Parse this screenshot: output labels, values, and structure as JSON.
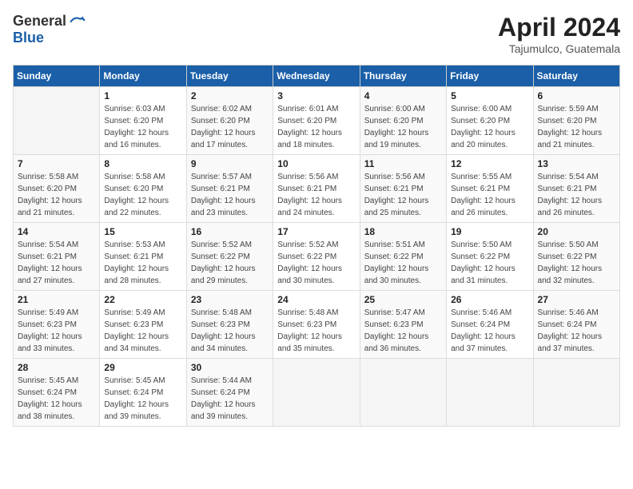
{
  "logo": {
    "general": "General",
    "blue": "Blue"
  },
  "title": {
    "month": "April 2024",
    "location": "Tajumulco, Guatemala"
  },
  "headers": [
    "Sunday",
    "Monday",
    "Tuesday",
    "Wednesday",
    "Thursday",
    "Friday",
    "Saturday"
  ],
  "weeks": [
    [
      {
        "day": "",
        "info": ""
      },
      {
        "day": "1",
        "info": "Sunrise: 6:03 AM\nSunset: 6:20 PM\nDaylight: 12 hours\nand 16 minutes."
      },
      {
        "day": "2",
        "info": "Sunrise: 6:02 AM\nSunset: 6:20 PM\nDaylight: 12 hours\nand 17 minutes."
      },
      {
        "day": "3",
        "info": "Sunrise: 6:01 AM\nSunset: 6:20 PM\nDaylight: 12 hours\nand 18 minutes."
      },
      {
        "day": "4",
        "info": "Sunrise: 6:00 AM\nSunset: 6:20 PM\nDaylight: 12 hours\nand 19 minutes."
      },
      {
        "day": "5",
        "info": "Sunrise: 6:00 AM\nSunset: 6:20 PM\nDaylight: 12 hours\nand 20 minutes."
      },
      {
        "day": "6",
        "info": "Sunrise: 5:59 AM\nSunset: 6:20 PM\nDaylight: 12 hours\nand 21 minutes."
      }
    ],
    [
      {
        "day": "7",
        "info": "Sunrise: 5:58 AM\nSunset: 6:20 PM\nDaylight: 12 hours\nand 21 minutes."
      },
      {
        "day": "8",
        "info": "Sunrise: 5:58 AM\nSunset: 6:20 PM\nDaylight: 12 hours\nand 22 minutes."
      },
      {
        "day": "9",
        "info": "Sunrise: 5:57 AM\nSunset: 6:21 PM\nDaylight: 12 hours\nand 23 minutes."
      },
      {
        "day": "10",
        "info": "Sunrise: 5:56 AM\nSunset: 6:21 PM\nDaylight: 12 hours\nand 24 minutes."
      },
      {
        "day": "11",
        "info": "Sunrise: 5:56 AM\nSunset: 6:21 PM\nDaylight: 12 hours\nand 25 minutes."
      },
      {
        "day": "12",
        "info": "Sunrise: 5:55 AM\nSunset: 6:21 PM\nDaylight: 12 hours\nand 26 minutes."
      },
      {
        "day": "13",
        "info": "Sunrise: 5:54 AM\nSunset: 6:21 PM\nDaylight: 12 hours\nand 26 minutes."
      }
    ],
    [
      {
        "day": "14",
        "info": "Sunrise: 5:54 AM\nSunset: 6:21 PM\nDaylight: 12 hours\nand 27 minutes."
      },
      {
        "day": "15",
        "info": "Sunrise: 5:53 AM\nSunset: 6:21 PM\nDaylight: 12 hours\nand 28 minutes."
      },
      {
        "day": "16",
        "info": "Sunrise: 5:52 AM\nSunset: 6:22 PM\nDaylight: 12 hours\nand 29 minutes."
      },
      {
        "day": "17",
        "info": "Sunrise: 5:52 AM\nSunset: 6:22 PM\nDaylight: 12 hours\nand 30 minutes."
      },
      {
        "day": "18",
        "info": "Sunrise: 5:51 AM\nSunset: 6:22 PM\nDaylight: 12 hours\nand 30 minutes."
      },
      {
        "day": "19",
        "info": "Sunrise: 5:50 AM\nSunset: 6:22 PM\nDaylight: 12 hours\nand 31 minutes."
      },
      {
        "day": "20",
        "info": "Sunrise: 5:50 AM\nSunset: 6:22 PM\nDaylight: 12 hours\nand 32 minutes."
      }
    ],
    [
      {
        "day": "21",
        "info": "Sunrise: 5:49 AM\nSunset: 6:23 PM\nDaylight: 12 hours\nand 33 minutes."
      },
      {
        "day": "22",
        "info": "Sunrise: 5:49 AM\nSunset: 6:23 PM\nDaylight: 12 hours\nand 34 minutes."
      },
      {
        "day": "23",
        "info": "Sunrise: 5:48 AM\nSunset: 6:23 PM\nDaylight: 12 hours\nand 34 minutes."
      },
      {
        "day": "24",
        "info": "Sunrise: 5:48 AM\nSunset: 6:23 PM\nDaylight: 12 hours\nand 35 minutes."
      },
      {
        "day": "25",
        "info": "Sunrise: 5:47 AM\nSunset: 6:23 PM\nDaylight: 12 hours\nand 36 minutes."
      },
      {
        "day": "26",
        "info": "Sunrise: 5:46 AM\nSunset: 6:24 PM\nDaylight: 12 hours\nand 37 minutes."
      },
      {
        "day": "27",
        "info": "Sunrise: 5:46 AM\nSunset: 6:24 PM\nDaylight: 12 hours\nand 37 minutes."
      }
    ],
    [
      {
        "day": "28",
        "info": "Sunrise: 5:45 AM\nSunset: 6:24 PM\nDaylight: 12 hours\nand 38 minutes."
      },
      {
        "day": "29",
        "info": "Sunrise: 5:45 AM\nSunset: 6:24 PM\nDaylight: 12 hours\nand 39 minutes."
      },
      {
        "day": "30",
        "info": "Sunrise: 5:44 AM\nSunset: 6:24 PM\nDaylight: 12 hours\nand 39 minutes."
      },
      {
        "day": "",
        "info": ""
      },
      {
        "day": "",
        "info": ""
      },
      {
        "day": "",
        "info": ""
      },
      {
        "day": "",
        "info": ""
      }
    ]
  ]
}
